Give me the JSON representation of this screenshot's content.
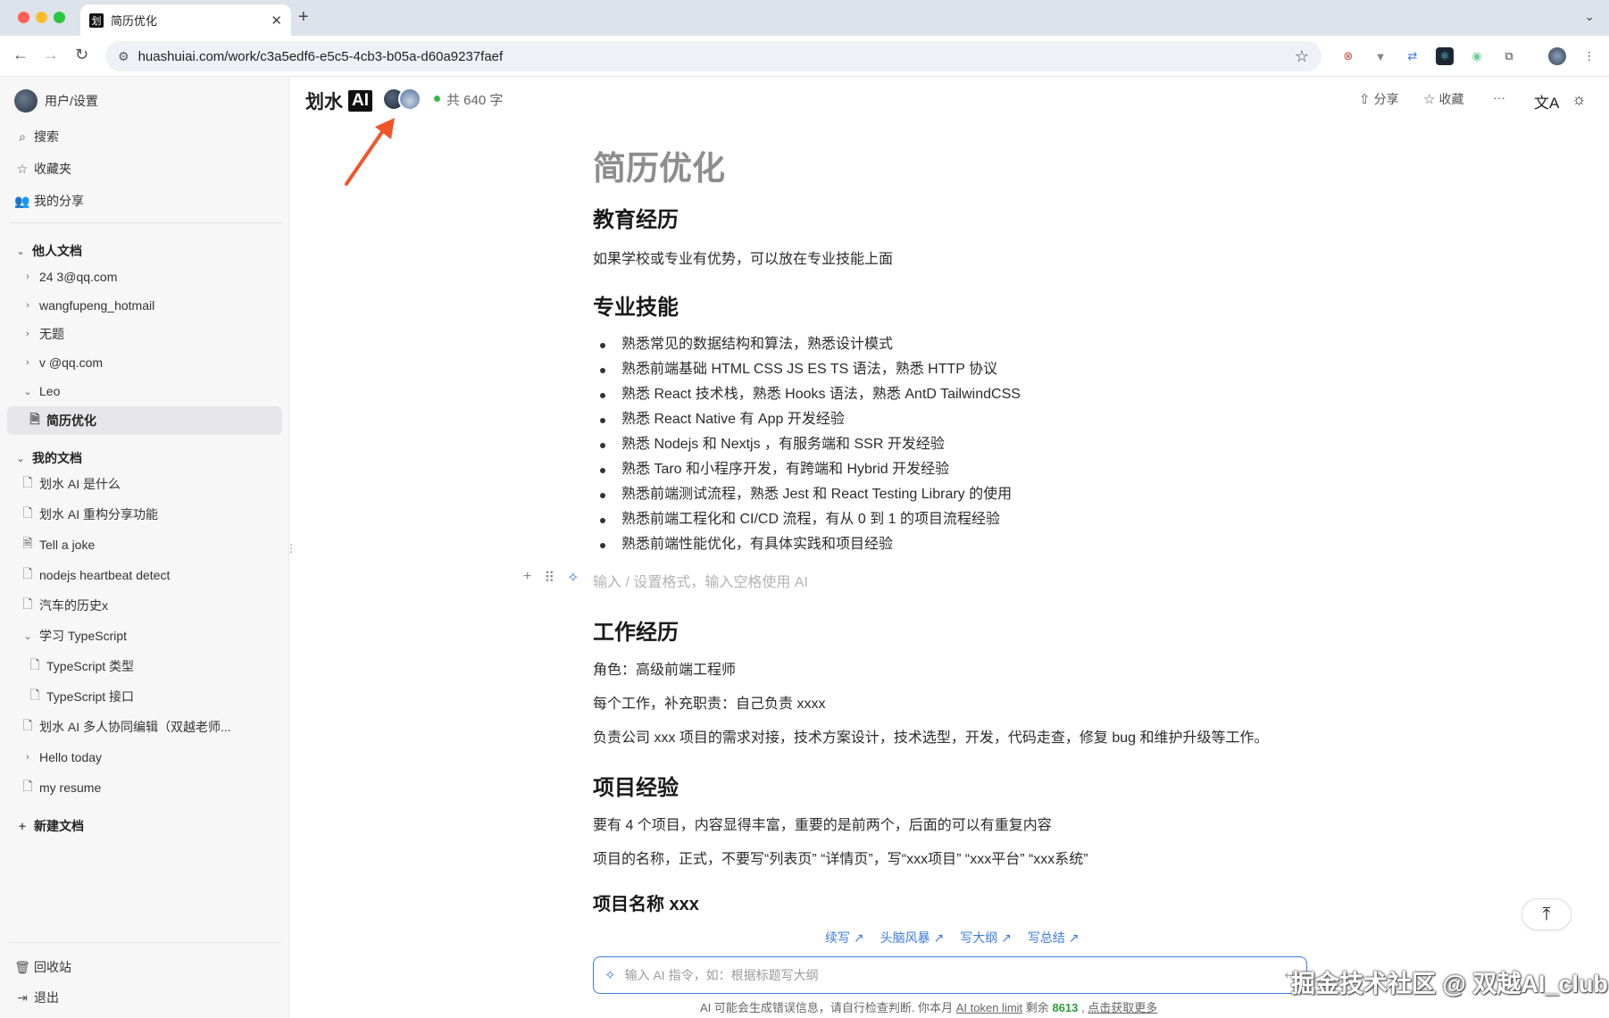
{
  "browser": {
    "tab_title": "简历优化",
    "favicon_text": "划",
    "url": "huashuiai.com/work/c3a5edf6-e5c5-4cb3-b05a-d60a9237faef"
  },
  "sidebar": {
    "user_settings": "用户/设置",
    "search": "搜索",
    "favorites": "收藏夹",
    "my_shares": "我的分享",
    "others_docs_header": "他人文档",
    "others_docs": [
      "24        3@qq.com",
      "wangfupeng_hotmail",
      "无题",
      "v       @qq.com"
    ],
    "leo": "Leo",
    "leo_doc_active": "简历优化",
    "my_docs_header": "我的文档",
    "my_docs": [
      "划水 AI 是什么",
      "划水 AI 重构分享功能",
      "Tell a joke",
      "nodejs heartbeat detect",
      "汽车的历史x"
    ],
    "ts_folder": "学习 TypeScript",
    "ts_children": [
      "TypeScript 类型",
      "TypeScript 接口"
    ],
    "my_docs_more": [
      "划水 AI 多人协同编辑（双越老师..."
    ],
    "hello_today": "Hello today",
    "my_resume": "my resume",
    "new_doc": "新建文档",
    "trash": "回收站",
    "logout": "退出"
  },
  "header": {
    "brand_text": "划水",
    "brand_ai": "AI",
    "word_count": "共 640 字",
    "share": "分享",
    "favorite": "收藏",
    "more": "···"
  },
  "doc": {
    "title": "简历优化",
    "education_heading": "教育经历",
    "education_text": "如果学校或专业有优势，可以放在专业技能上面",
    "skills_heading": "专业技能",
    "skills": [
      "熟悉常见的数据结构和算法，熟悉设计模式",
      "熟悉前端基础 HTML CSS JS ES TS 语法，熟悉 HTTP 协议",
      "熟悉 React 技术栈，熟悉 Hooks 语法，熟悉 AntD TailwindCSS",
      "熟悉 React Native 有 App 开发经验",
      "熟悉 Nodejs 和 Nextjs ，有服务端和 SSR 开发经验",
      "熟悉 Taro 和小程序开发，有跨端和 Hybrid 开发经验",
      "熟悉前端测试流程，熟悉 Jest 和 React Testing Library 的使用",
      "熟悉前端工程化和 CI/CD 流程，有从 0 到 1 的项目流程经验",
      "熟悉前端性能优化，有具体实践和项目经验"
    ],
    "empty_line_placeholder": "输入 / 设置格式，输入空格使用 AI",
    "work_heading": "工作经历",
    "work_lines": [
      "角色：高级前端工程师",
      "每个工作，补充职责：自己负责 xxxx",
      "负责公司 xxx 项目的需求对接，技术方案设计，技术选型，开发，代码走查，修复 bug 和维护升级等工作。"
    ],
    "project_heading": "项目经验",
    "project_lines": [
      "要有 4 个项目，内容显得丰富，重要的是前两个，后面的可以有重复内容",
      "项目的名称，正式，不要写“列表页” “详情页”，写“xxx项目” “xxx平台” “xxx系统”"
    ],
    "project_name_heading": "项目名称 xxx"
  },
  "ai": {
    "actions": [
      "续写 ↗",
      "头脑风暴 ↗",
      "写大纲 ↗",
      "写总结 ↗"
    ],
    "input_placeholder": "输入 AI 指令，如：根据标题写大纲",
    "footer_text": "AI 可能会生成错误信息，请自行检查判断. 你本月",
    "footer_link": "AI token limit",
    "footer_remaining": "剩余",
    "footer_number": "8613",
    "footer_more": "点击获取更多"
  },
  "watermark": "掘金技术社区 @ 双越AI_club",
  "icons": {
    "search": "search-icon",
    "star": "star-icon",
    "users": "users-icon",
    "doc": "doc-icon",
    "trash": "trash-icon",
    "logout": "logout-icon",
    "share": "share-icon",
    "translate": "translate-icon",
    "theme": "sun-icon"
  },
  "colors": {
    "accent": "#3d7ce0",
    "arrow": "#f0552a",
    "online": "#3bb54a",
    "token_number": "#2a9d3c"
  }
}
